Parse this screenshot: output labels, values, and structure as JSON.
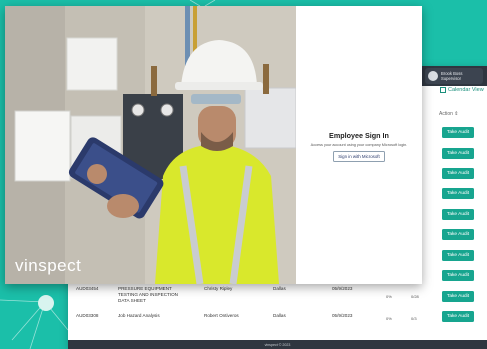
{
  "brand": {
    "logo_text": "vinspect"
  },
  "signin": {
    "title": "Employee Sign In",
    "subtitle": "Access your account using your company Microsoft login.",
    "ms_button": "Sign in with Microsoft"
  },
  "dashboard": {
    "user": {
      "name": "Brook Boss",
      "role": "Supervisor"
    },
    "calendar_link": "Calendar View",
    "action_header": "Action",
    "take_audit_label": "Take Audit",
    "rows": [
      {
        "id": "AUD03454",
        "title": "PRESSURE EQUIPMENT TESTING AND INSPECTION DATA SHEET",
        "assignee": "Christy Ripley",
        "location": "Dallas",
        "date": "05/9/2023",
        "pct": "0%",
        "count": "0/28"
      },
      {
        "id": "AUD03308",
        "title": "Job Hazard Analysis",
        "assignee": "Robert Ontiveros",
        "location": "Dallas",
        "date": "05/9/2023",
        "pct": "0%",
        "count": "0/3"
      }
    ],
    "footer": "vinspect © 2023"
  },
  "colors": {
    "teal": "#1bbfa9",
    "button": "#17a58f",
    "topbar": "#2f3640"
  }
}
